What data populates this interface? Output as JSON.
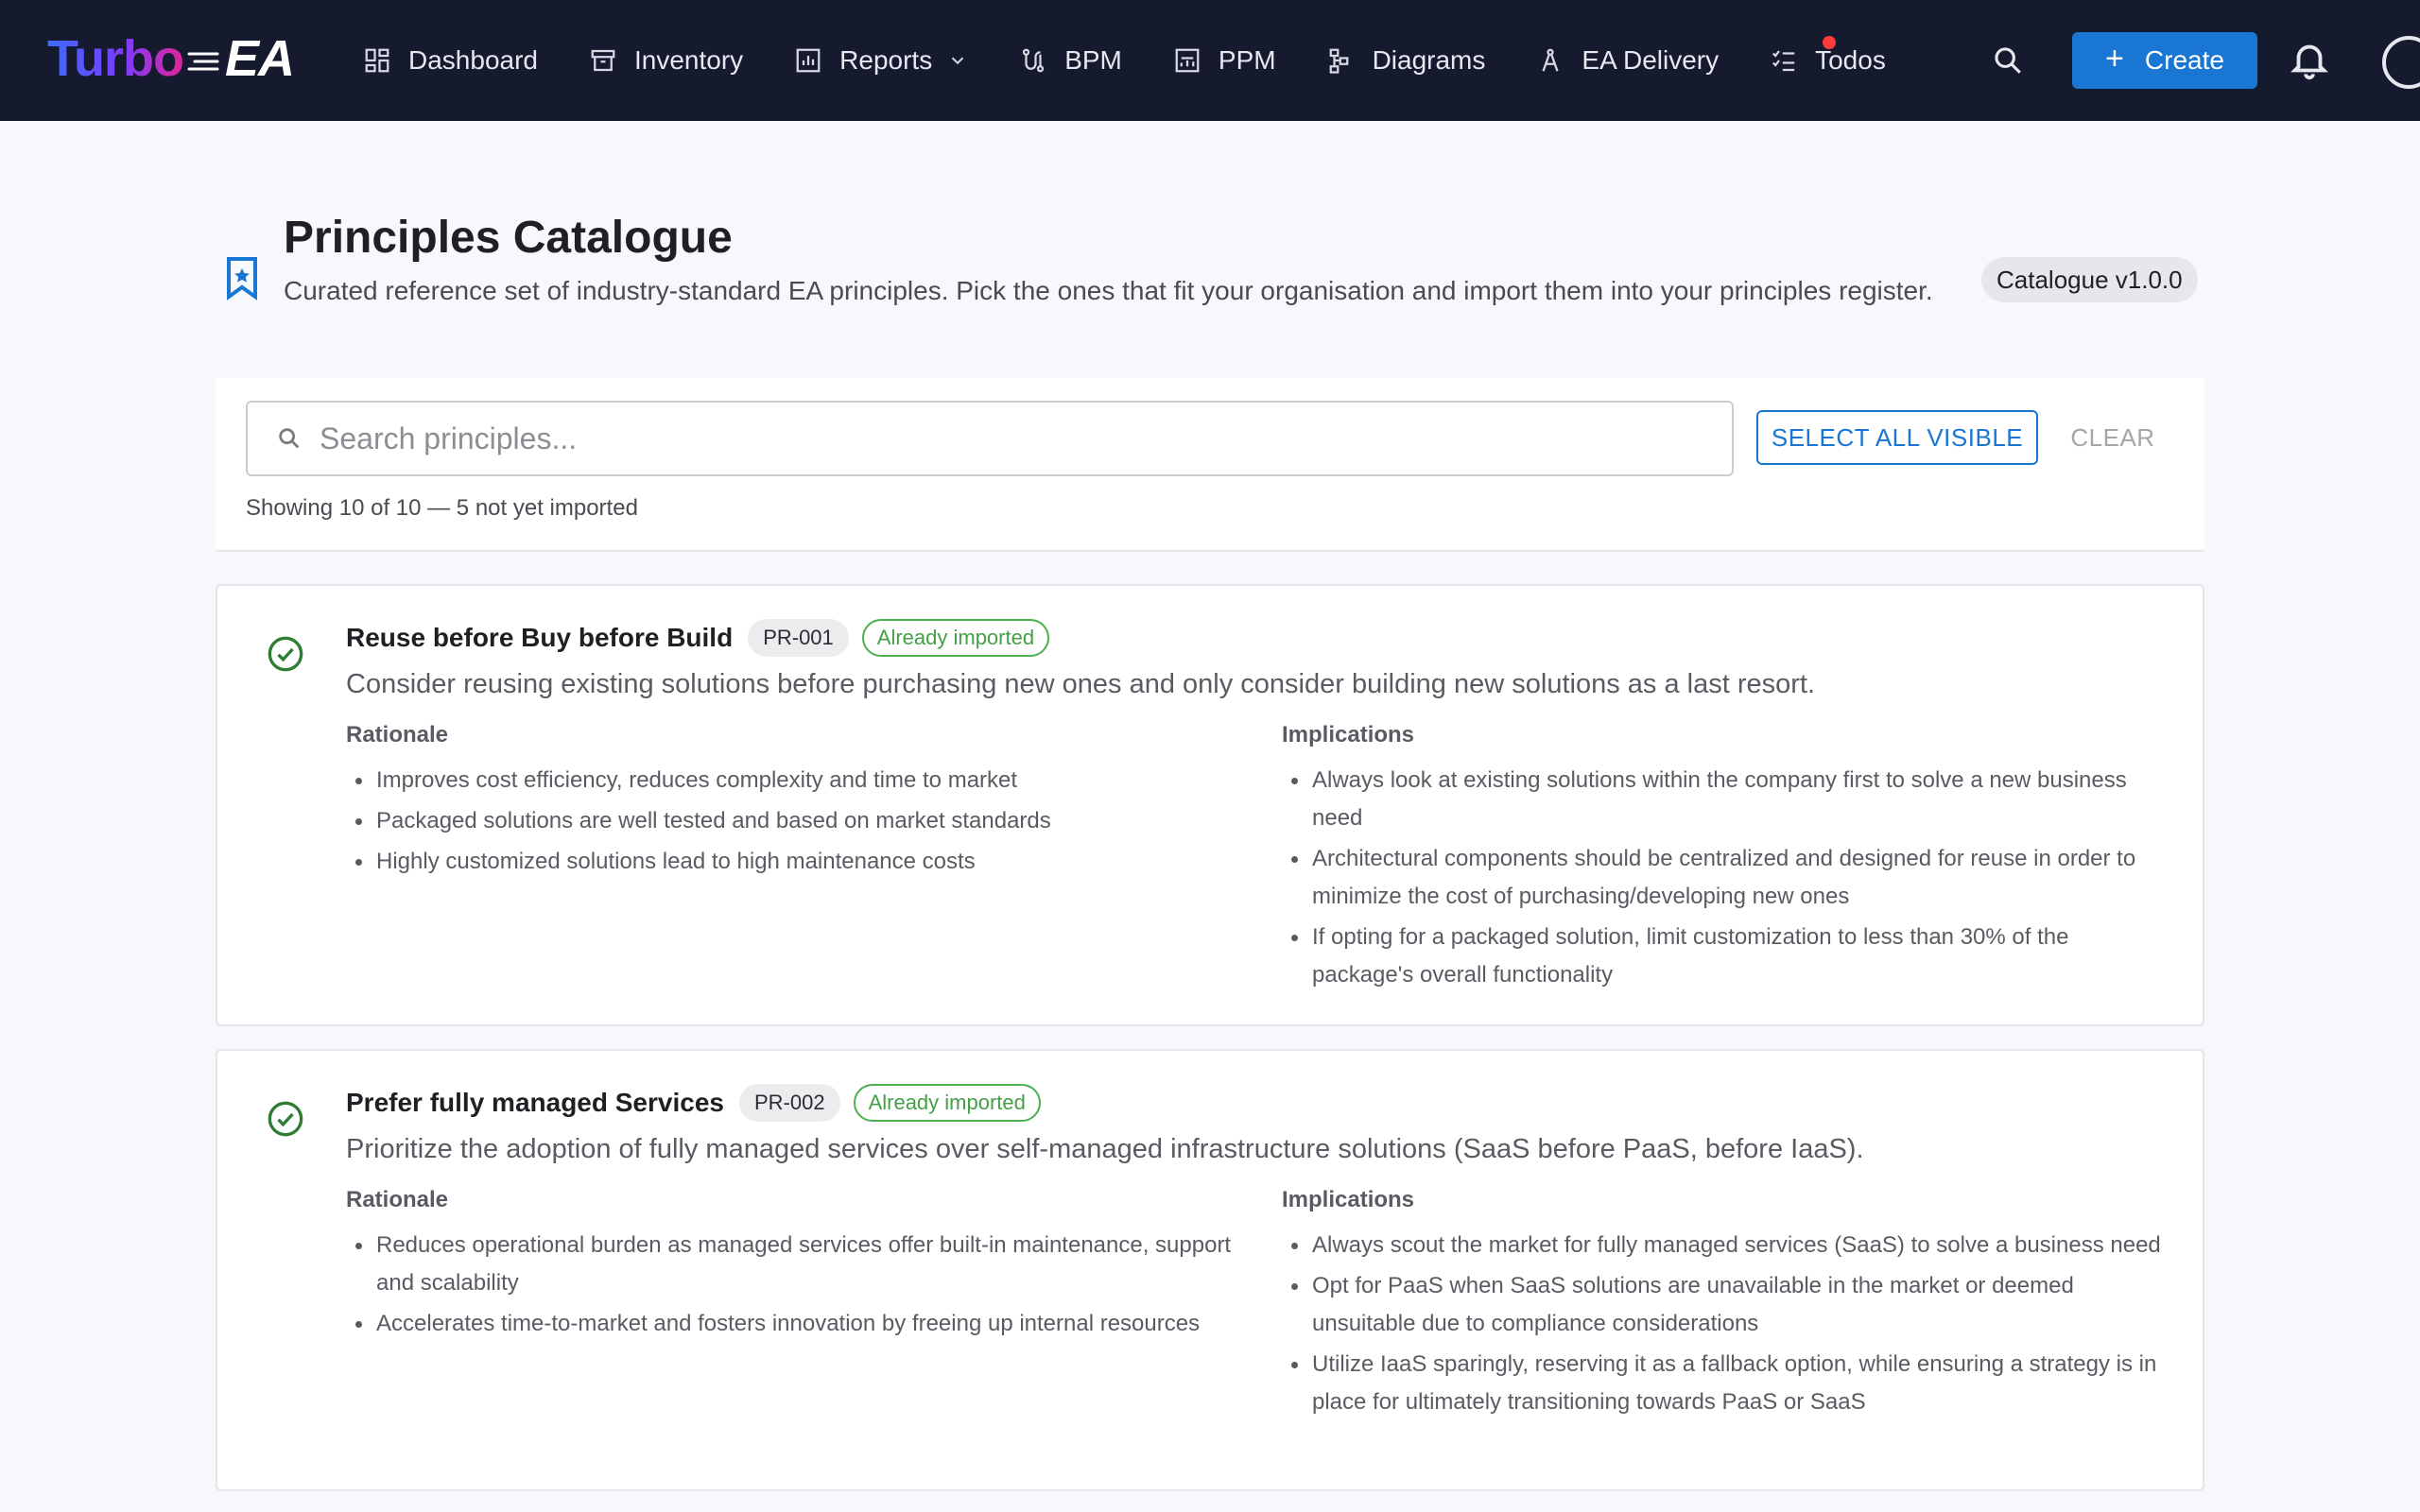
{
  "brand": {
    "name_part1": "Turbo",
    "name_part2": "EA"
  },
  "nav": {
    "items": [
      {
        "label": "Dashboard",
        "icon": "dashboard-icon"
      },
      {
        "label": "Inventory",
        "icon": "archive-icon"
      },
      {
        "label": "Reports",
        "icon": "bar-chart-icon"
      },
      {
        "label": "BPM",
        "icon": "route-icon"
      },
      {
        "label": "PPM",
        "icon": "chart-box-icon"
      },
      {
        "label": "Diagrams",
        "icon": "flow-icon"
      },
      {
        "label": "EA Delivery",
        "icon": "compass-icon"
      },
      {
        "label": "Todos",
        "icon": "checklist-icon"
      }
    ],
    "create_label": "Create"
  },
  "header": {
    "title": "Principles Catalogue",
    "subtitle": "Curated reference set of industry-standard EA principles. Pick the ones that fit your organisation and import them into your principles register.",
    "version": "Catalogue v1.0.0"
  },
  "filters": {
    "search_placeholder": "Search principles...",
    "search_value": "",
    "select_all_label": "SELECT ALL VISIBLE",
    "clear_label": "CLEAR",
    "showing_text": "Showing 10 of 10 — 5 not yet imported"
  },
  "principles": [
    {
      "title": "Reuse before Buy before Build",
      "code": "PR-001",
      "status": "Already imported",
      "description": "Consider reusing existing solutions before purchasing new ones and only consider building new solutions as a last resort.",
      "rationale_label": "Rationale",
      "implications_label": "Implications",
      "rationale": [
        "Improves cost efficiency, reduces complexity and time to market",
        "Packaged solutions are well tested and based on market standards",
        "Highly customized solutions lead to high maintenance costs"
      ],
      "implications": [
        "Always look at existing solutions within the company first to solve a new business need",
        "Architectural components should be centralized and designed for reuse in order to minimize the cost of purchasing/developing new ones",
        "If opting for a packaged solution, limit customization to less than 30% of the package's overall functionality"
      ]
    },
    {
      "title": "Prefer fully managed Services",
      "code": "PR-002",
      "status": "Already imported",
      "description": "Prioritize the adoption of fully managed services over self-managed infrastructure solutions (SaaS before PaaS, before IaaS).",
      "rationale_label": "Rationale",
      "implications_label": "Implications",
      "rationale": [
        "Reduces operational burden as managed services offer built-in maintenance, support and scalability",
        "Accelerates time-to-market and fosters innovation by freeing up internal resources"
      ],
      "implications": [
        "Always scout the market for fully managed services (SaaS) to solve a business need",
        "Opt for PaaS when SaaS solutions are unavailable in the market or deemed unsuitable due to compliance considerations",
        "Utilize IaaS sparingly, reserving it as a fallback option, while ensuring a strategy is in place for ultimately transitioning towards PaaS or SaaS"
      ]
    }
  ],
  "colors": {
    "topbar": "#161a2e",
    "accent": "#1976d2",
    "imported": "#43a047"
  }
}
